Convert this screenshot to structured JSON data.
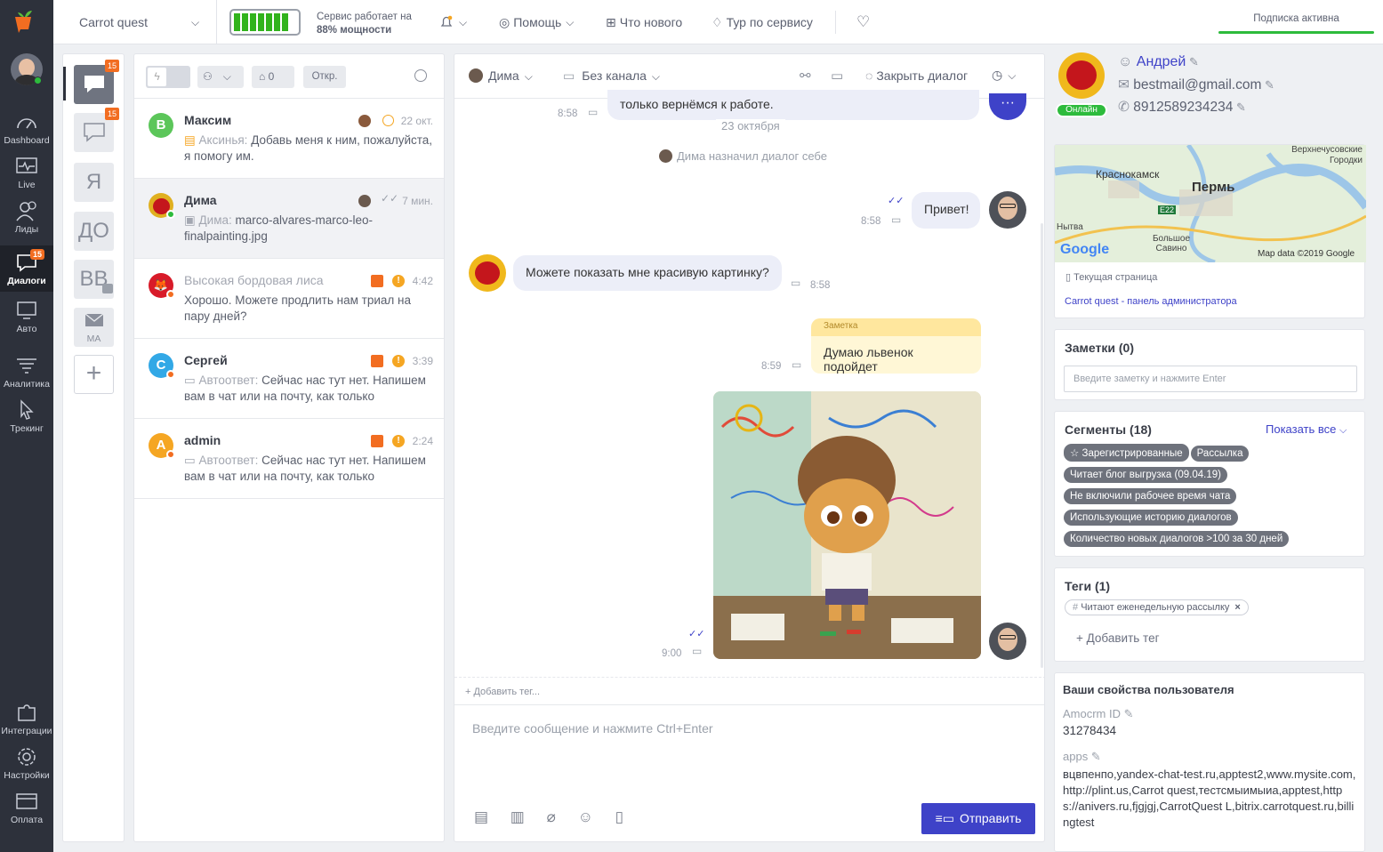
{
  "colors": {
    "accent": "#3e42c8",
    "orange": "#f26d21",
    "sidebar": "#2d313b",
    "online": "#2dbb3c"
  },
  "nav": {
    "items": [
      {
        "label": "Dashboard",
        "icon": "gauge-icon"
      },
      {
        "label": "Live",
        "icon": "pulse-icon"
      },
      {
        "label": "Лиды",
        "icon": "users-icon"
      },
      {
        "label": "Диалоги",
        "icon": "chat-icon",
        "badge": "15"
      },
      {
        "label": "Авто",
        "icon": "monitor-icon"
      },
      {
        "label": "Аналитика",
        "icon": "filter-icon"
      },
      {
        "label": "Трекинг",
        "icon": "cursor-icon"
      },
      {
        "label": "Интеграции",
        "icon": "puzzle-icon"
      },
      {
        "label": "Настройки",
        "icon": "gear-icon"
      },
      {
        "label": "Оплата",
        "icon": "card-icon"
      }
    ]
  },
  "topbar": {
    "project": "Carrot quest",
    "service_line1": "Сервис работает на",
    "service_line2": "88% мощности",
    "service_level": 0.88,
    "help": "Помощь",
    "whats_new": "Что нового",
    "tour": "Тур по сервису",
    "subscription": "Подписка активна"
  },
  "inboxes": {
    "badge1": "15",
    "badge2": "15",
    "ya": "Я",
    "do": "ДО",
    "vv": "ВВ",
    "ma": "MA"
  },
  "list": {
    "tags_count": "0",
    "status": "Откр.",
    "conversations": [
      {
        "name": "Максим",
        "avatar": "В",
        "time": "22 окт.",
        "author": "Аксинья:",
        "text": "Добавь меня к ним, пожалуйста, я помогу им."
      },
      {
        "name": "Дима",
        "time": "7 мин.",
        "author": "Дима:",
        "text": "marco-alvares-marco-leo-finalpainting.jpg"
      },
      {
        "name": "Высокая бордовая лиса",
        "time": "4:42",
        "author": "",
        "text": "Хорошо. Можете продлить нам триал на пару дней?"
      },
      {
        "name": "Сергей",
        "avatar": "С",
        "time": "3:39",
        "author": "Автоответ:",
        "text": "Сейчас нас тут нет. Напишем вам в чат или на почту, как только"
      },
      {
        "name": "admin",
        "avatar": "A",
        "time": "2:24",
        "author": "Автоответ:",
        "text": "Сейчас нас тут нет. Напишем вам в чат или на почту, как только"
      }
    ]
  },
  "chat": {
    "assignee": "Дима",
    "channel": "Без канала",
    "close": "Закрыть диалог",
    "msg_top": "только вернёмся к работе.",
    "time_top": "8:58",
    "date": "23 октября",
    "system": "Дима назначил диалог себе",
    "msg_hi": "Привет!",
    "time_hi": "8:58",
    "msg_q": "Можете показать мне красивую картинку?",
    "time_q": "8:58",
    "note_label": "Заметка",
    "note_text": "Думаю львенок подойдет",
    "time_note": "8:59",
    "time_img": "9:00",
    "add_tag": "+ Добавить тег...",
    "input_placeholder": "Введите сообщение и нажмите Ctrl+Enter",
    "send": "Отправить"
  },
  "user": {
    "name": "Андрей",
    "email": "bestmail@gmail.com",
    "phone": "8912589234234",
    "online": "Онлайн",
    "map": {
      "city1": "Краснокамск",
      "city2": "Пермь",
      "city3": "Верхнечусовские Городки",
      "city4": "Нытва",
      "city5": "Большое Савино",
      "road": "E22",
      "google": "Google",
      "credit": "Map data ©2019 Google"
    },
    "current_page_label": "Текущая страница",
    "current_page": "Carrot quest - панель администратора",
    "notes_title": "Заметки (0)",
    "notes_placeholder": "Введите заметку и нажмите Enter",
    "segments_title": "Сегменты (18)",
    "show_all": "Показать все",
    "segments": [
      "Зарегистрированные",
      "Рассылка",
      "Читает блог выгрузка (09.04.19)",
      "Не включили рабочее время чата",
      "Использующие историю диалогов",
      "Количество новых диалогов >100 за 30 дней"
    ],
    "tags_title": "Теги (1)",
    "tag": "Читают еженедельную рассылку",
    "add_tag": "+ Добавить тег",
    "props_title": "Ваши свойства пользователя",
    "prop1_name": "Amocrm ID",
    "prop1_value": "31278434",
    "prop2_name": "apps",
    "prop2_value": "вцвпенпо,yandex-chat-test.ru,apptest2,www.mysite.com,http://plint.us,Carrot quest,тестсмыимыиа,apptest,https://anivers.ru,fjgjgj,CarrotQuest L,bitrix.carrotquest.ru,billingtest"
  }
}
